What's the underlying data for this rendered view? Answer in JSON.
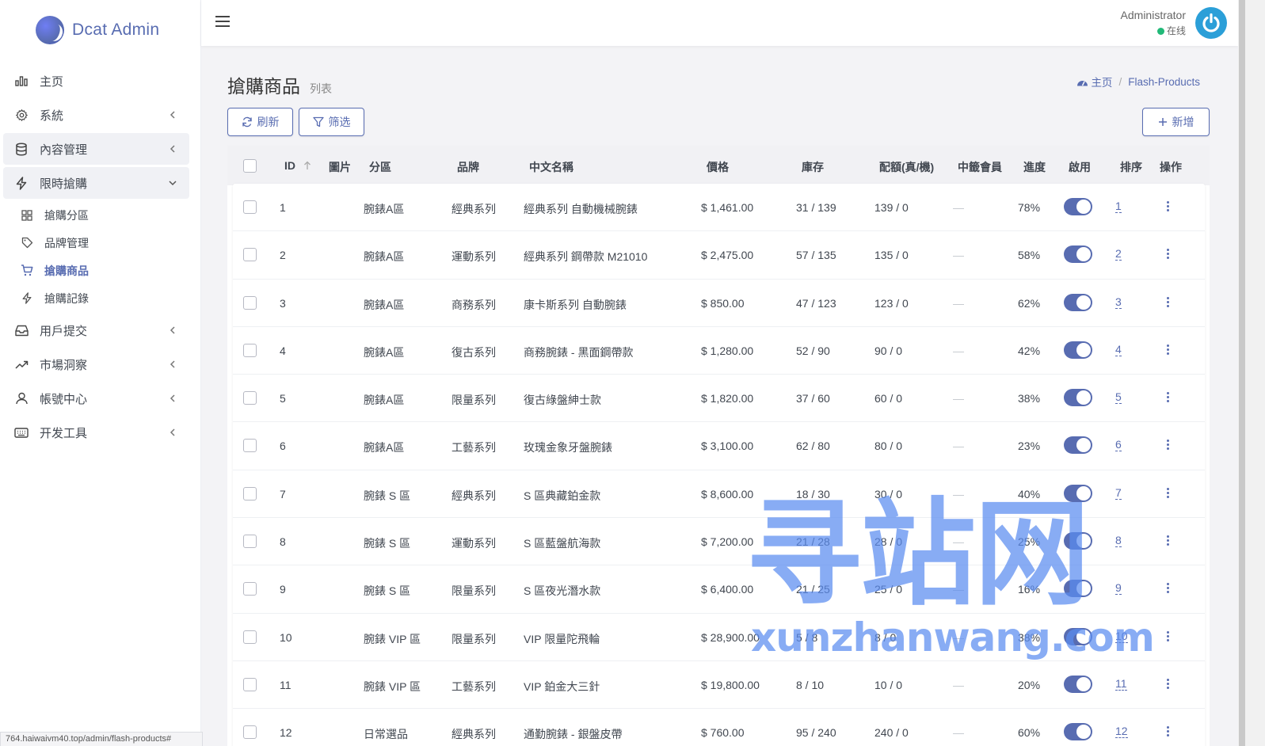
{
  "brand": {
    "name": "Dcat Admin"
  },
  "sidebar": {
    "items": [
      {
        "label": "主页",
        "icon": "bar-chart-icon"
      },
      {
        "label": "系統",
        "icon": "gear-icon"
      },
      {
        "label": "內容管理",
        "icon": "database-icon"
      },
      {
        "label": "限時搶購",
        "icon": "lightning-icon"
      },
      {
        "label": "用戶提交",
        "icon": "inbox-icon"
      },
      {
        "label": "市場洞察",
        "icon": "trending-up-icon"
      },
      {
        "label": "帳號中心",
        "icon": "user-icon"
      },
      {
        "label": "开发工具",
        "icon": "keyboard-icon"
      }
    ],
    "sub_items": [
      {
        "label": "搶購分區",
        "icon": "grid-icon"
      },
      {
        "label": "品牌管理",
        "icon": "tag-icon"
      },
      {
        "label": "搶購商品",
        "icon": "cart-icon"
      },
      {
        "label": "搶購記錄",
        "icon": "lightning-icon"
      }
    ]
  },
  "statusbar": {
    "url": "764.haiwaivm40.top/admin/flash-products#"
  },
  "header": {
    "user_name": "Administrator",
    "user_status": "在线"
  },
  "page": {
    "title": "搶購商品",
    "subtitle": "列表"
  },
  "breadcrumb": {
    "home": "主页",
    "current": "Flash-Products"
  },
  "toolbar": {
    "refresh": "刷新",
    "filter": "筛选",
    "add": "新增"
  },
  "table": {
    "headers": {
      "id": "ID",
      "image": "圖片",
      "zone": "分區",
      "brand": "品牌",
      "name": "中文名稱",
      "price": "價格",
      "stock": "庫存",
      "quota": "配額(真/機)",
      "winners": "中籤會員",
      "progress": "進度",
      "enabled": "啟用",
      "order": "排序",
      "actions": "操作"
    },
    "rows": [
      {
        "id": "1",
        "zone": "腕錶A區",
        "brand": "經典系列",
        "name": "經典系列 自動機械腕錶",
        "price": "$ 1,461.00",
        "stock": "31 / 139",
        "quota": "139 / 0",
        "winners": "—",
        "progress": "78%",
        "enabled": true,
        "order": "1"
      },
      {
        "id": "2",
        "zone": "腕錶A區",
        "brand": "運動系列",
        "name": "經典系列 鋼帶款 M21010",
        "price": "$ 2,475.00",
        "stock": "57 / 135",
        "quota": "135 / 0",
        "winners": "—",
        "progress": "58%",
        "enabled": true,
        "order": "2"
      },
      {
        "id": "3",
        "zone": "腕錶A區",
        "brand": "商務系列",
        "name": "康卡斯系列 自動腕錶",
        "price": "$ 850.00",
        "stock": "47 / 123",
        "quota": "123 / 0",
        "winners": "—",
        "progress": "62%",
        "enabled": true,
        "order": "3"
      },
      {
        "id": "4",
        "zone": "腕錶A區",
        "brand": "復古系列",
        "name": "商務腕錶 - 黑面鋼帶款",
        "price": "$ 1,280.00",
        "stock": "52 / 90",
        "quota": "90 / 0",
        "winners": "—",
        "progress": "42%",
        "enabled": true,
        "order": "4"
      },
      {
        "id": "5",
        "zone": "腕錶A區",
        "brand": "限量系列",
        "name": "復古綠盤紳士款",
        "price": "$ 1,820.00",
        "stock": "37 / 60",
        "quota": "60 / 0",
        "winners": "—",
        "progress": "38%",
        "enabled": true,
        "order": "5"
      },
      {
        "id": "6",
        "zone": "腕錶A區",
        "brand": "工藝系列",
        "name": "玫瑰金象牙盤腕錶",
        "price": "$ 3,100.00",
        "stock": "62 / 80",
        "quota": "80 / 0",
        "winners": "—",
        "progress": "23%",
        "enabled": true,
        "order": "6"
      },
      {
        "id": "7",
        "zone": "腕錶 S 區",
        "brand": "經典系列",
        "name": "S 區典藏鉑金款",
        "price": "$ 8,600.00",
        "stock": "18 / 30",
        "quota": "30 / 0",
        "winners": "—",
        "progress": "40%",
        "enabled": true,
        "order": "7"
      },
      {
        "id": "8",
        "zone": "腕錶 S 區",
        "brand": "運動系列",
        "name": "S 區藍盤航海款",
        "price": "$ 7,200.00",
        "stock": "21 / 28",
        "quota": "28 / 0",
        "winners": "—",
        "progress": "25%",
        "enabled": true,
        "order": "8"
      },
      {
        "id": "9",
        "zone": "腕錶 S 區",
        "brand": "限量系列",
        "name": "S 區夜光潛水款",
        "price": "$ 6,400.00",
        "stock": "21 / 25",
        "quota": "25 / 0",
        "winners": "—",
        "progress": "16%",
        "enabled": true,
        "order": "9"
      },
      {
        "id": "10",
        "zone": "腕錶 VIP 區",
        "brand": "限量系列",
        "name": "VIP 限量陀飛輪",
        "price": "$ 28,900.00",
        "stock": "5 / 8",
        "quota": "8 / 0",
        "winners": "—",
        "progress": "38%",
        "enabled": true,
        "order": "10"
      },
      {
        "id": "11",
        "zone": "腕錶 VIP 區",
        "brand": "工藝系列",
        "name": "VIP 鉑金大三針",
        "price": "$ 19,800.00",
        "stock": "8 / 10",
        "quota": "10 / 0",
        "winners": "—",
        "progress": "20%",
        "enabled": true,
        "order": "11"
      },
      {
        "id": "12",
        "zone": "日常選品",
        "brand": "經典系列",
        "name": "通勤腕錶 - 銀盤皮帶",
        "price": "$ 760.00",
        "stock": "95 / 240",
        "quota": "240 / 0",
        "winners": "—",
        "progress": "60%",
        "enabled": true,
        "order": "12"
      }
    ]
  },
  "watermark": {
    "big": "寻站网",
    "small": "xunzhanwang.com"
  },
  "colors": {
    "accent": "#586cb1",
    "online": "#21b978",
    "avatar": "#2b9fd8"
  }
}
